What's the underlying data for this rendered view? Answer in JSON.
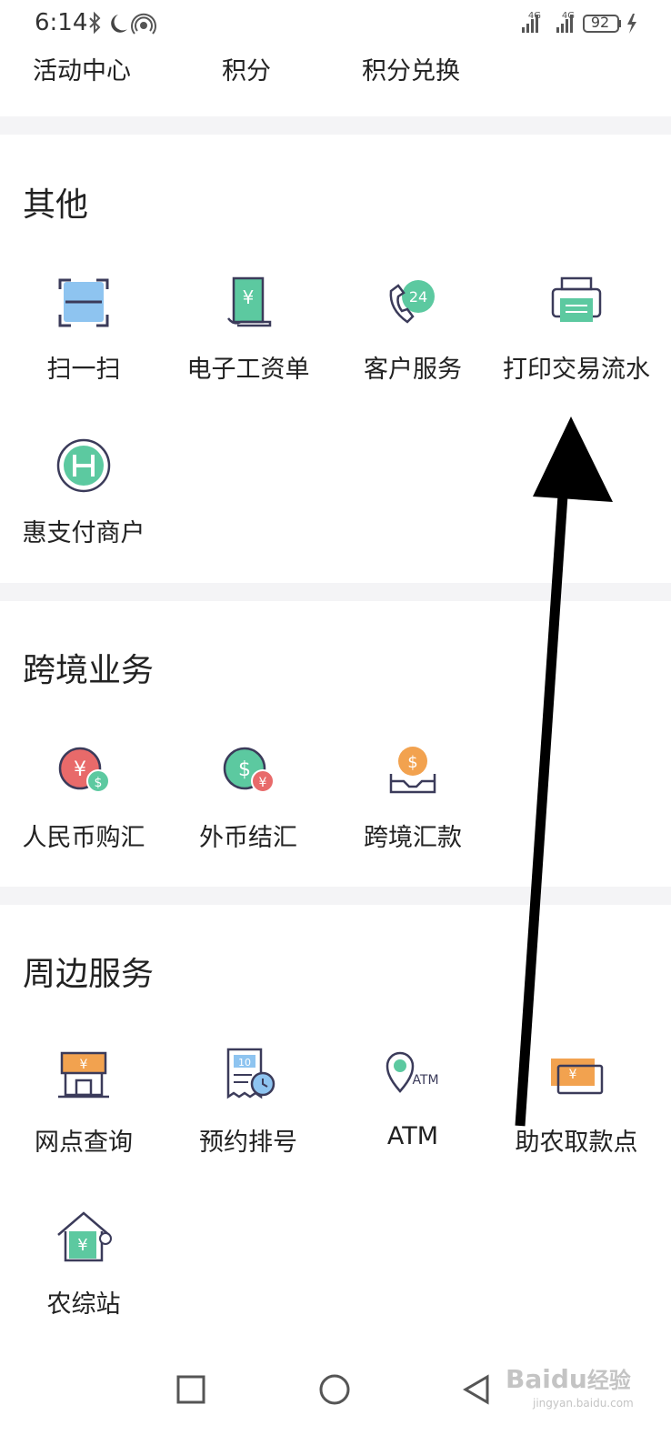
{
  "status_bar": {
    "time": "6:14",
    "network_left": "4G",
    "network_right": "4G",
    "battery": "92"
  },
  "top_links": [
    "活动中心",
    "积分",
    "积分兑换"
  ],
  "sections": [
    {
      "title": "其他",
      "items": [
        {
          "label": "扫一扫",
          "icon": "scan-icon"
        },
        {
          "label": "电子工资单",
          "icon": "salary-slip-icon"
        },
        {
          "label": "客户服务",
          "icon": "customer-service-24-icon"
        },
        {
          "label": "打印交易流水",
          "icon": "printer-icon"
        },
        {
          "label": "惠支付商户",
          "icon": "merchant-pay-icon"
        }
      ]
    },
    {
      "title": "跨境业务",
      "items": [
        {
          "label": "人民币购汇",
          "icon": "rmb-exchange-icon"
        },
        {
          "label": "外币结汇",
          "icon": "foreign-currency-settlement-icon"
        },
        {
          "label": "跨境汇款",
          "icon": "cross-border-remit-icon"
        }
      ]
    },
    {
      "title": "周边服务",
      "items": [
        {
          "label": "网点查询",
          "icon": "branch-store-icon"
        },
        {
          "label": "预约排号",
          "icon": "queue-ticket-icon"
        },
        {
          "label": "ATM",
          "icon": "atm-location-icon"
        },
        {
          "label": "助农取款点",
          "icon": "withdrawal-point-icon"
        },
        {
          "label": "农综站",
          "icon": "rural-station-icon"
        }
      ]
    }
  ],
  "watermark": {
    "brand": "Baidu",
    "suffix": "经验",
    "url": "jingyan.baidu.com"
  },
  "colors": {
    "green": "#5cc9a0",
    "blue": "#8ec4f0",
    "red": "#e86a6a",
    "orange": "#f2a24f",
    "outline": "#3b3b5a",
    "gap": "#f4f4f6"
  }
}
